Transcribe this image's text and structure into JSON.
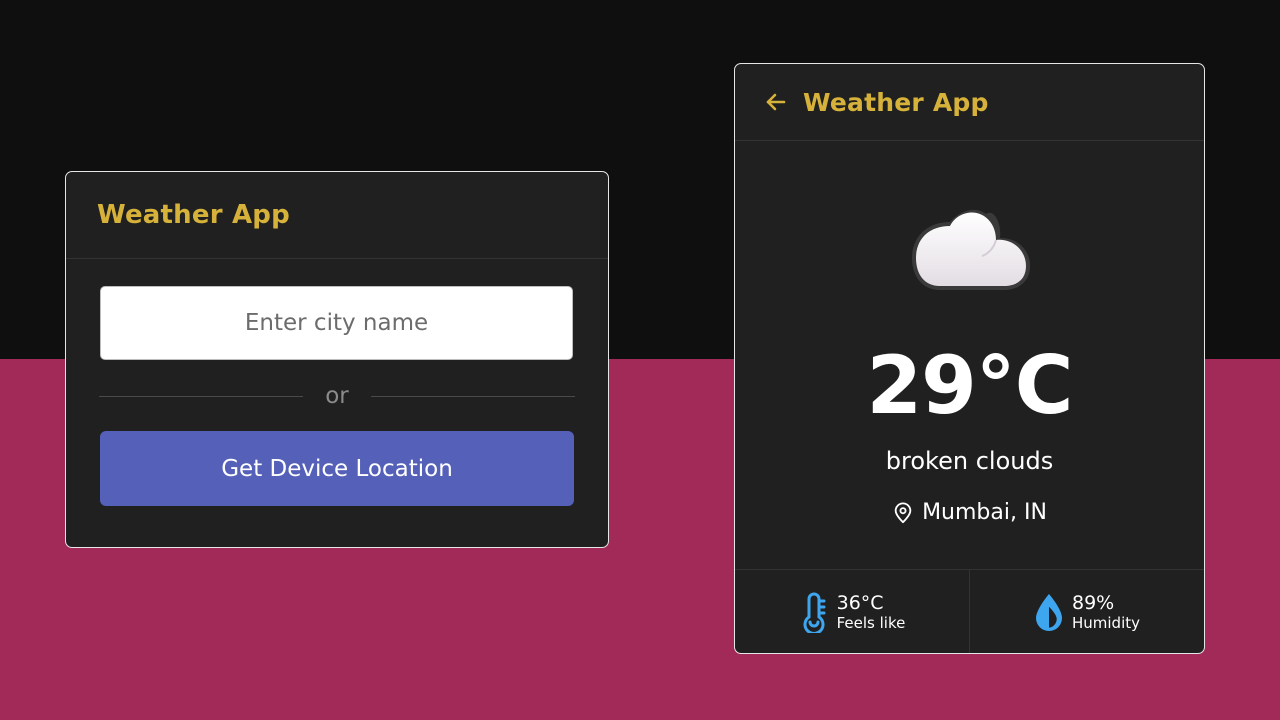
{
  "colors": {
    "background_top": "#0f0f0f",
    "background_bottom": "#a22a58",
    "card": "#202020",
    "accent_title": "#d7b23a",
    "button": "#5560b8",
    "icon_blue": "#3ea6ee"
  },
  "search_card": {
    "title": "Weather App",
    "city_input": {
      "placeholder": "Enter city name",
      "value": ""
    },
    "divider_text": "or",
    "location_button_label": "Get Device Location"
  },
  "weather_card": {
    "title": "Weather App",
    "back_icon": "arrow-left-icon",
    "condition_icon": "cloud-icon",
    "temperature": "29°C",
    "description": "broken clouds",
    "location_icon": "map-pin-icon",
    "location": "Mumbai, IN",
    "stats": [
      {
        "icon": "thermometer-icon",
        "value": "36°C",
        "label": "Feels like"
      },
      {
        "icon": "water-drop-icon",
        "value": "89%",
        "label": "Humidity"
      }
    ]
  }
}
